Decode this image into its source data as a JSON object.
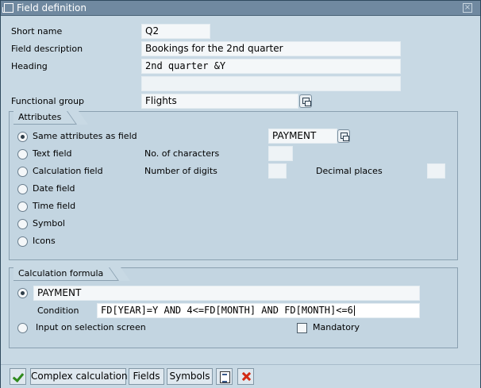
{
  "window": {
    "title": "Field definition",
    "close_glyph": "×"
  },
  "form": {
    "short_name": {
      "label": "Short name",
      "value": "Q2"
    },
    "field_description": {
      "label": "Field description",
      "value": "Bookings for the 2nd quarter"
    },
    "heading": {
      "label": "Heading",
      "value": "2nd quarter &Y",
      "value2": ""
    },
    "functional_group": {
      "label": "Functional group",
      "value": "Flights"
    }
  },
  "attributes": {
    "title": "Attributes",
    "options": [
      {
        "label": "Same attributes as field",
        "selected": true
      },
      {
        "label": "Text field",
        "selected": false
      },
      {
        "label": "Calculation field",
        "selected": false
      },
      {
        "label": "Date field",
        "selected": false
      },
      {
        "label": "Time field",
        "selected": false
      },
      {
        "label": "Symbol",
        "selected": false
      },
      {
        "label": "Icons",
        "selected": false
      }
    ],
    "same_field_value": "PAYMENT",
    "no_of_characters_label": "No. of characters",
    "no_of_characters_value": "",
    "number_of_digits_label": "Number of digits",
    "number_of_digits_value": "",
    "decimal_places_label": "Decimal places",
    "decimal_places_value": ""
  },
  "calculation": {
    "title": "Calculation formula",
    "formula_value": "PAYMENT",
    "formula_selected": true,
    "condition_label": "Condition",
    "condition_value": "FD[YEAR]=Y AND 4<=FD[MONTH] AND FD[MONTH]<=6",
    "input_on_selection_label": "Input on selection screen",
    "input_on_selection_selected": false,
    "mandatory_label": "Mandatory",
    "mandatory_checked": false
  },
  "toolbar": {
    "confirm_icon": "check-icon",
    "complex_calculation": "Complex calculation",
    "fields": "Fields",
    "symbols": "Symbols",
    "list_icon": "list-icon",
    "cancel_icon": "cancel-icon",
    "colors": {
      "confirm": "#2f8a1d",
      "cancel": "#d22a14"
    }
  }
}
